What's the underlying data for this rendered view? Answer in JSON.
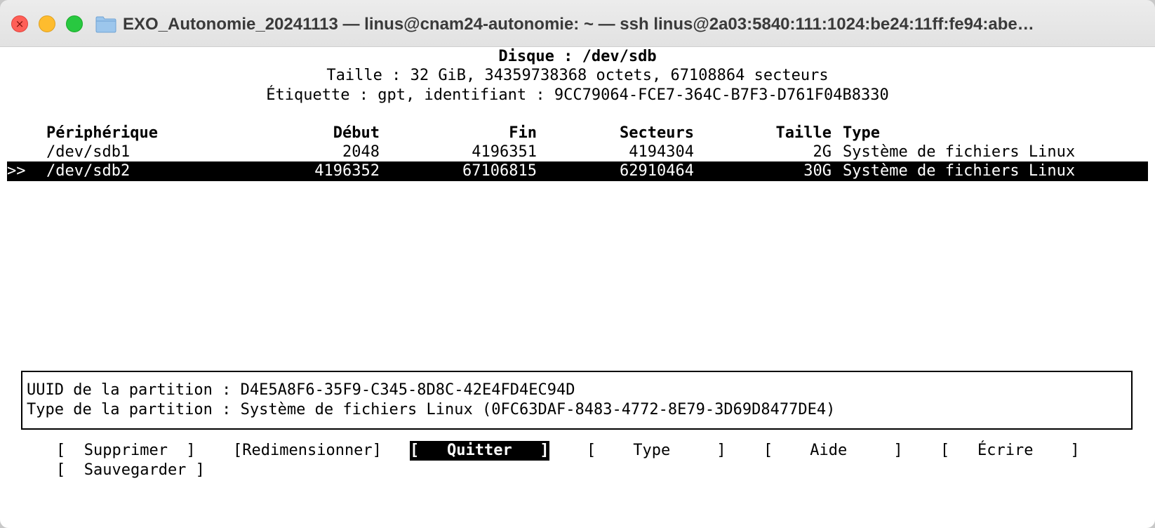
{
  "window": {
    "title": "EXO_Autonomie_20241113 — linus@cnam24-autonomie: ~ — ssh linus@2a03:5840:111:1024:be24:11ff:fe94:abe…",
    "close_glyph": "×",
    "icons": [
      "close-button",
      "minimize-button",
      "zoom-button",
      "folder-icon"
    ]
  },
  "disk": {
    "heading": "Disque : /dev/sdb",
    "size_line": "Taille : 32 GiB, 34359738368 octets, 67108864 secteurs",
    "label_line": "Étiquette : gpt, identifiant : 9CC79064-FCE7-364C-B7F3-D761F04B8330"
  },
  "table": {
    "headers": {
      "device": "Périphérique",
      "start": "Début",
      "end": "Fin",
      "sectors": "Secteurs",
      "size": "Taille",
      "type": "Type"
    },
    "rows": [
      {
        "marker": "",
        "device": "/dev/sdb1",
        "start": "2048",
        "end": "4196351",
        "sectors": "4194304",
        "size": "2G",
        "type": "Système de fichiers Linux",
        "selected": false
      },
      {
        "marker": ">>",
        "device": "/dev/sdb2",
        "start": "4196352",
        "end": "67106815",
        "sectors": "62910464",
        "size": "30G",
        "type": "Système de fichiers Linux",
        "selected": true
      }
    ]
  },
  "partition_info": {
    "uuid_line": "UUID de la partition : D4E5A8F6-35F9-C345-8D8C-42E4FD4EC94D",
    "type_line": "Type de la partition : Système de fichiers Linux (0FC63DAF-8483-4772-8E79-3D69D8477DE4)"
  },
  "menu": {
    "delete": "[  Supprimer  ]",
    "resize": "[Redimensionner]",
    "quit": "[   Quitter   ]",
    "type": "[    Type     ]",
    "help": "[    Aide     ]",
    "write": "[   Écrire    ]",
    "save": "[  Sauvegarder ]",
    "active": "quit"
  },
  "colors": {
    "selection_bg": "#000000",
    "selection_fg": "#ffffff",
    "close": "#ff5f57",
    "minimize": "#febc2e",
    "zoom": "#28c840"
  }
}
